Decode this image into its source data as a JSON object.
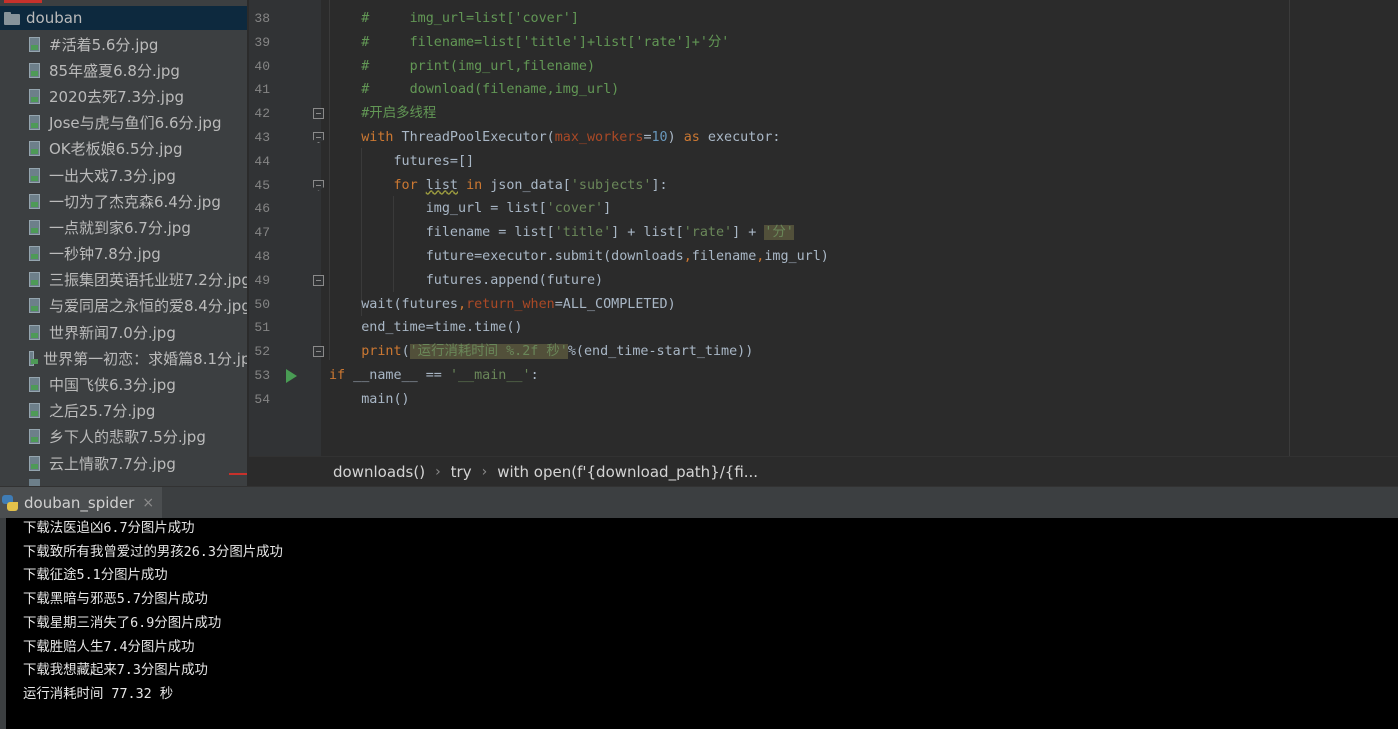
{
  "project_tree": {
    "folder": "douban",
    "files": [
      "#活着5.6分.jpg",
      "85年盛夏6.8分.jpg",
      "2020去死7.3分.jpg",
      "Jose与虎与鱼们6.6分.jpg",
      "OK老板娘6.5分.jpg",
      "一出大戏7.3分.jpg",
      "一切为了杰克森6.4分.jpg",
      "一点就到家6.7分.jpg",
      "一秒钟7.8分.jpg",
      "三振集团英语托业班7.2分.jpg",
      "与爱同居之永恒的爱8.4分.jpg",
      "世界新闻7.0分.jpg",
      "世界第一初恋：求婚篇8.1分.jpg",
      "中国飞侠6.3分.jpg",
      "之后25.7分.jpg",
      "乡下人的悲歌7.5分.jpg",
      "云上情歌7.7分.jpg"
    ]
  },
  "editor": {
    "lines": [
      {
        "n": "38",
        "fold": "",
        "tokens": [
          [
            "    #     img_url=list['cover']",
            "c-cmt"
          ]
        ]
      },
      {
        "n": "39",
        "fold": "",
        "tokens": [
          [
            "    #     filename=list['title']+list['rate']+'分'",
            "c-cmt"
          ]
        ]
      },
      {
        "n": "40",
        "fold": "",
        "tokens": [
          [
            "    #     print(img_url,filename)",
            "c-cmt"
          ]
        ]
      },
      {
        "n": "41",
        "fold": "",
        "tokens": [
          [
            "    #     download(filename,img_url)",
            "c-cmt"
          ]
        ]
      },
      {
        "n": "42",
        "fold": "end",
        "tokens": [
          [
            "    #开启多线程",
            "c-cmt"
          ]
        ]
      },
      {
        "n": "43",
        "fold": "open",
        "tokens": [
          [
            "    ",
            ""
          ],
          [
            "with",
            "c-kw"
          ],
          [
            " ThreadPoolExecutor(",
            ""
          ],
          [
            "max_workers",
            "c-kwarg"
          ],
          [
            "=",
            ""
          ],
          [
            "10",
            "c-num"
          ],
          [
            ") ",
            ""
          ],
          [
            "as",
            "c-kw"
          ],
          [
            " executor:",
            ""
          ]
        ]
      },
      {
        "n": "44",
        "fold": "",
        "tokens": [
          [
            "        futures=[]",
            ""
          ]
        ]
      },
      {
        "n": "45",
        "fold": "open",
        "tokens": [
          [
            "        ",
            ""
          ],
          [
            "for",
            "c-kw"
          ],
          [
            " ",
            ""
          ],
          [
            "list",
            "c-warn"
          ],
          [
            " ",
            ""
          ],
          [
            "in",
            "c-kw"
          ],
          [
            " json_data[",
            ""
          ],
          [
            "'subjects'",
            "c-str"
          ],
          [
            "]:",
            ""
          ]
        ]
      },
      {
        "n": "46",
        "fold": "",
        "tokens": [
          [
            "            img_url = list[",
            ""
          ],
          [
            "'cover'",
            "c-str"
          ],
          [
            "]",
            ""
          ]
        ]
      },
      {
        "n": "47",
        "fold": "",
        "tokens": [
          [
            "            filename = list[",
            ""
          ],
          [
            "'title'",
            "c-str"
          ],
          [
            "] + list[",
            ""
          ],
          [
            "'rate'",
            "c-str"
          ],
          [
            "] + ",
            ""
          ],
          [
            "'分'",
            "c-str c-hl"
          ]
        ]
      },
      {
        "n": "48",
        "fold": "",
        "tokens": [
          [
            "            future=executor.submit(downloads",
            ""
          ],
          [
            ",",
            "c-kw"
          ],
          [
            "filename",
            ""
          ],
          [
            ",",
            "c-kw"
          ],
          [
            "img_url)",
            ""
          ]
        ]
      },
      {
        "n": "49",
        "fold": "end",
        "tokens": [
          [
            "            futures.append(future)",
            ""
          ]
        ]
      },
      {
        "n": "50",
        "fold": "",
        "tokens": [
          [
            "    wait(futures",
            ""
          ],
          [
            ",",
            "c-kw"
          ],
          [
            "return_when",
            "c-kwarg"
          ],
          [
            "=ALL_COMPLETED)",
            ""
          ]
        ]
      },
      {
        "n": "51",
        "fold": "",
        "tokens": [
          [
            "    end_time=time.time()",
            ""
          ]
        ]
      },
      {
        "n": "52",
        "fold": "end",
        "tokens": [
          [
            "    ",
            ""
          ],
          [
            "print",
            "c-kw"
          ],
          [
            "(",
            ""
          ],
          [
            "'运行消耗时间 %.2f 秒'",
            "c-str c-hl"
          ],
          [
            "%(end_time-start_time))",
            ""
          ]
        ]
      },
      {
        "n": "53",
        "fold": "run",
        "tokens": [
          [
            "if",
            "c-kw"
          ],
          [
            " __name__ == ",
            ""
          ],
          [
            "'__main__'",
            "c-str"
          ],
          [
            ":",
            ""
          ]
        ]
      },
      {
        "n": "54",
        "fold": "",
        "tokens": [
          [
            "    main()",
            ""
          ]
        ]
      }
    ]
  },
  "breadcrumb": [
    "downloads()",
    "try",
    "with open(f'{download_path}/{fi..."
  ],
  "run_panel": {
    "tab_label": "douban_spider",
    "close_label": "×",
    "output": [
      "下载法医追凶6.7分图片成功",
      "下载致所有我曾爱过的男孩26.3分图片成功",
      "下载征途5.1分图片成功",
      "下载黑暗与邪恶5.7分图片成功",
      "下载星期三消失了6.9分图片成功",
      "下载胜赔人生7.4分图片成功",
      "下载我想藏起来7.3分图片成功",
      "运行消耗时间 77.32 秒"
    ]
  }
}
